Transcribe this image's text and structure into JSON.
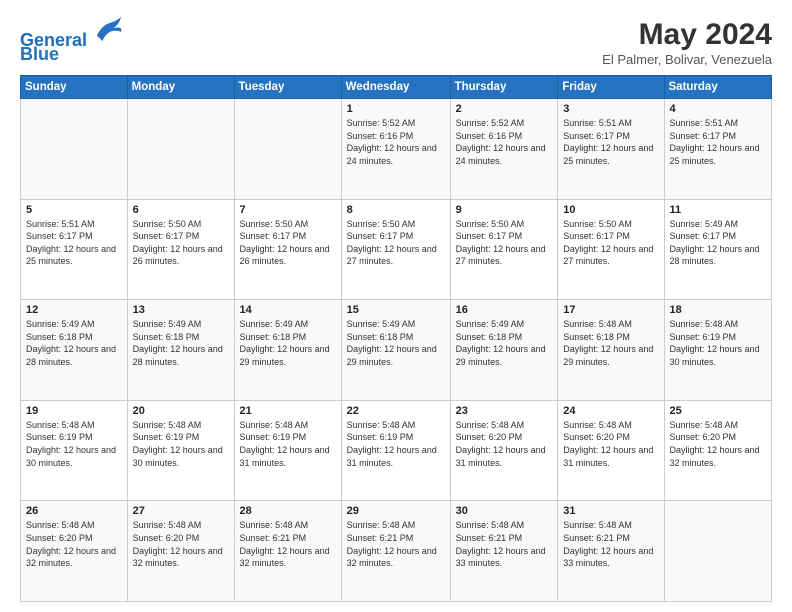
{
  "header": {
    "logo_line1": "General",
    "logo_line2": "Blue",
    "month_year": "May 2024",
    "location": "El Palmer, Bolivar, Venezuela"
  },
  "days_of_week": [
    "Sunday",
    "Monday",
    "Tuesday",
    "Wednesday",
    "Thursday",
    "Friday",
    "Saturday"
  ],
  "weeks": [
    [
      {
        "day": "",
        "info": ""
      },
      {
        "day": "",
        "info": ""
      },
      {
        "day": "",
        "info": ""
      },
      {
        "day": "1",
        "info": "Sunrise: 5:52 AM\nSunset: 6:16 PM\nDaylight: 12 hours and 24 minutes."
      },
      {
        "day": "2",
        "info": "Sunrise: 5:52 AM\nSunset: 6:16 PM\nDaylight: 12 hours and 24 minutes."
      },
      {
        "day": "3",
        "info": "Sunrise: 5:51 AM\nSunset: 6:17 PM\nDaylight: 12 hours and 25 minutes."
      },
      {
        "day": "4",
        "info": "Sunrise: 5:51 AM\nSunset: 6:17 PM\nDaylight: 12 hours and 25 minutes."
      }
    ],
    [
      {
        "day": "5",
        "info": "Sunrise: 5:51 AM\nSunset: 6:17 PM\nDaylight: 12 hours and 25 minutes."
      },
      {
        "day": "6",
        "info": "Sunrise: 5:50 AM\nSunset: 6:17 PM\nDaylight: 12 hours and 26 minutes."
      },
      {
        "day": "7",
        "info": "Sunrise: 5:50 AM\nSunset: 6:17 PM\nDaylight: 12 hours and 26 minutes."
      },
      {
        "day": "8",
        "info": "Sunrise: 5:50 AM\nSunset: 6:17 PM\nDaylight: 12 hours and 27 minutes."
      },
      {
        "day": "9",
        "info": "Sunrise: 5:50 AM\nSunset: 6:17 PM\nDaylight: 12 hours and 27 minutes."
      },
      {
        "day": "10",
        "info": "Sunrise: 5:50 AM\nSunset: 6:17 PM\nDaylight: 12 hours and 27 minutes."
      },
      {
        "day": "11",
        "info": "Sunrise: 5:49 AM\nSunset: 6:17 PM\nDaylight: 12 hours and 28 minutes."
      }
    ],
    [
      {
        "day": "12",
        "info": "Sunrise: 5:49 AM\nSunset: 6:18 PM\nDaylight: 12 hours and 28 minutes."
      },
      {
        "day": "13",
        "info": "Sunrise: 5:49 AM\nSunset: 6:18 PM\nDaylight: 12 hours and 28 minutes."
      },
      {
        "day": "14",
        "info": "Sunrise: 5:49 AM\nSunset: 6:18 PM\nDaylight: 12 hours and 29 minutes."
      },
      {
        "day": "15",
        "info": "Sunrise: 5:49 AM\nSunset: 6:18 PM\nDaylight: 12 hours and 29 minutes."
      },
      {
        "day": "16",
        "info": "Sunrise: 5:49 AM\nSunset: 6:18 PM\nDaylight: 12 hours and 29 minutes."
      },
      {
        "day": "17",
        "info": "Sunrise: 5:48 AM\nSunset: 6:18 PM\nDaylight: 12 hours and 29 minutes."
      },
      {
        "day": "18",
        "info": "Sunrise: 5:48 AM\nSunset: 6:19 PM\nDaylight: 12 hours and 30 minutes."
      }
    ],
    [
      {
        "day": "19",
        "info": "Sunrise: 5:48 AM\nSunset: 6:19 PM\nDaylight: 12 hours and 30 minutes."
      },
      {
        "day": "20",
        "info": "Sunrise: 5:48 AM\nSunset: 6:19 PM\nDaylight: 12 hours and 30 minutes."
      },
      {
        "day": "21",
        "info": "Sunrise: 5:48 AM\nSunset: 6:19 PM\nDaylight: 12 hours and 31 minutes."
      },
      {
        "day": "22",
        "info": "Sunrise: 5:48 AM\nSunset: 6:19 PM\nDaylight: 12 hours and 31 minutes."
      },
      {
        "day": "23",
        "info": "Sunrise: 5:48 AM\nSunset: 6:20 PM\nDaylight: 12 hours and 31 minutes."
      },
      {
        "day": "24",
        "info": "Sunrise: 5:48 AM\nSunset: 6:20 PM\nDaylight: 12 hours and 31 minutes."
      },
      {
        "day": "25",
        "info": "Sunrise: 5:48 AM\nSunset: 6:20 PM\nDaylight: 12 hours and 32 minutes."
      }
    ],
    [
      {
        "day": "26",
        "info": "Sunrise: 5:48 AM\nSunset: 6:20 PM\nDaylight: 12 hours and 32 minutes."
      },
      {
        "day": "27",
        "info": "Sunrise: 5:48 AM\nSunset: 6:20 PM\nDaylight: 12 hours and 32 minutes."
      },
      {
        "day": "28",
        "info": "Sunrise: 5:48 AM\nSunset: 6:21 PM\nDaylight: 12 hours and 32 minutes."
      },
      {
        "day": "29",
        "info": "Sunrise: 5:48 AM\nSunset: 6:21 PM\nDaylight: 12 hours and 32 minutes."
      },
      {
        "day": "30",
        "info": "Sunrise: 5:48 AM\nSunset: 6:21 PM\nDaylight: 12 hours and 33 minutes."
      },
      {
        "day": "31",
        "info": "Sunrise: 5:48 AM\nSunset: 6:21 PM\nDaylight: 12 hours and 33 minutes."
      },
      {
        "day": "",
        "info": ""
      }
    ]
  ]
}
